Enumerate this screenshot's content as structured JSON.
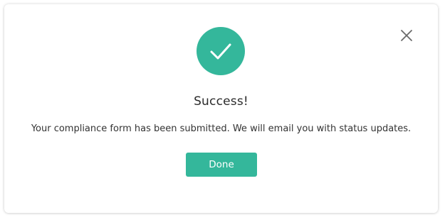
{
  "dialog": {
    "title": "Success!",
    "message": "Your compliance form has been submitted. We will email you with status updates.",
    "done_label": "Done",
    "status_icon": "check-circle-icon",
    "close_icon": "close-icon"
  },
  "colors": {
    "accent": "#34b79b",
    "close_icon": "#6b6b6b",
    "title_text": "#2b2b2b",
    "body_text": "#333333"
  }
}
